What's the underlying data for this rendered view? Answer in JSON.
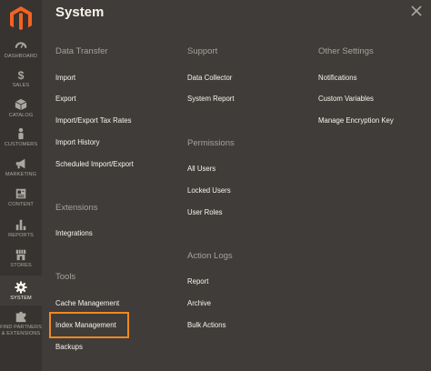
{
  "sidebar": {
    "logo": "magento-logo",
    "items": [
      {
        "label": "DASHBOARD",
        "icon": "dashboard-icon"
      },
      {
        "label": "SALES",
        "icon": "dollar-icon"
      },
      {
        "label": "CATALOG",
        "icon": "box-icon"
      },
      {
        "label": "CUSTOMERS",
        "icon": "person-icon"
      },
      {
        "label": "MARKETING",
        "icon": "megaphone-icon"
      },
      {
        "label": "CONTENT",
        "icon": "content-icon"
      },
      {
        "label": "REPORTS",
        "icon": "bar-chart-icon"
      },
      {
        "label": "STORES",
        "icon": "store-icon"
      },
      {
        "label": "SYSTEM",
        "icon": "gear-icon",
        "active": true
      },
      {
        "label": "FIND PARTNERS & EXTENSIONS",
        "label_line1": "FIND PARTNERS",
        "label_line2": "& EXTENSIONS",
        "icon": "puzzle-icon"
      }
    ]
  },
  "panel": {
    "title": "System",
    "close_icon": "close-icon",
    "highlight_color": "#f0891f",
    "columns": [
      {
        "sections": [
          {
            "title": "Data Transfer",
            "links": [
              "Import",
              "Export",
              "Import/Export Tax Rates",
              "Import History",
              "Scheduled Import/Export"
            ]
          },
          {
            "title": "Extensions",
            "links": [
              "Integrations"
            ]
          },
          {
            "title": "Tools",
            "links": [
              "Cache Management",
              "Index Management",
              "Backups"
            ]
          }
        ]
      },
      {
        "sections": [
          {
            "title": "Support",
            "links": [
              "Data Collector",
              "System Report"
            ]
          },
          {
            "title": "Permissions",
            "links": [
              "All Users",
              "Locked Users",
              "User Roles"
            ]
          },
          {
            "title": "Action Logs",
            "links": [
              "Report",
              "Archive",
              "Bulk Actions"
            ]
          }
        ]
      },
      {
        "sections": [
          {
            "title": "Other Settings",
            "links": [
              "Notifications",
              "Custom Variables",
              "Manage Encryption Key"
            ]
          }
        ]
      }
    ]
  }
}
